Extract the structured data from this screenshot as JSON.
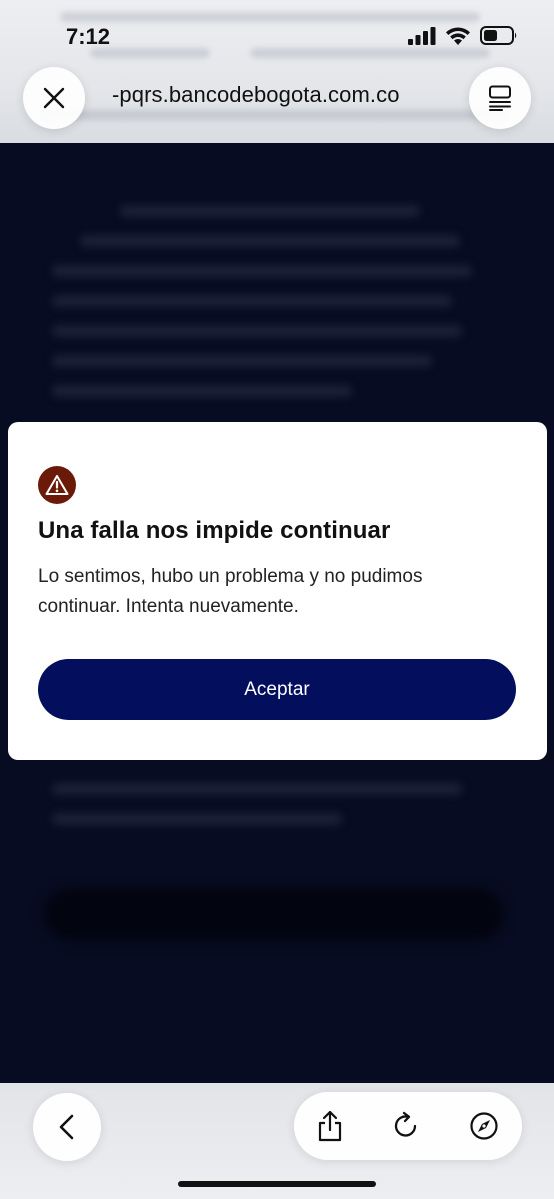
{
  "status_bar": {
    "time": "7:12",
    "icons": [
      "cellular-signal-icon",
      "wifi-icon",
      "battery-icon"
    ]
  },
  "browser": {
    "url": "-pqrs.bancodebogota.com.co",
    "close_icon": "close-icon",
    "tabs_icon": "tabs-icon"
  },
  "modal": {
    "icon": "warning-icon",
    "icon_color": "#6b1a0a",
    "title": "Una falla nos impide continuar",
    "message": "Lo sentimos, hubo un problema y no pudimos continuar. Intenta nuevamente.",
    "accept_label": "Aceptar",
    "accept_color": "#030f5c"
  },
  "toolbar": {
    "icons": [
      "back-icon",
      "share-icon",
      "reload-icon",
      "compass-icon"
    ]
  }
}
